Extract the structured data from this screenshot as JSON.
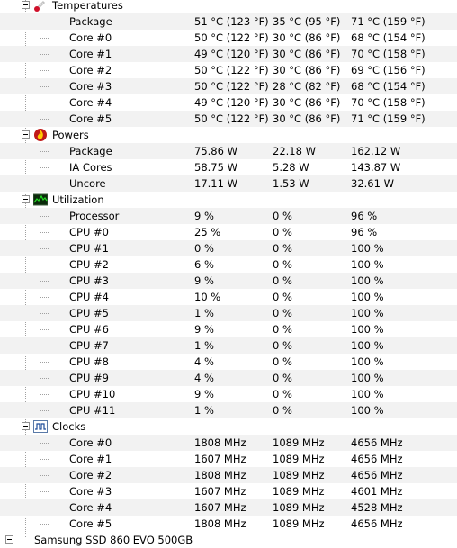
{
  "categories": [
    {
      "name": "Temperatures",
      "icon": "thermometer-icon",
      "rows": [
        {
          "label": "Package",
          "value": "51 °C  (123 °F)",
          "min": "35 °C  (95 °F)",
          "max": "71 °C  (159 °F)"
        },
        {
          "label": "Core #0",
          "value": "50 °C  (122 °F)",
          "min": "30 °C  (86 °F)",
          "max": "68 °C  (154 °F)"
        },
        {
          "label": "Core #1",
          "value": "49 °C  (120 °F)",
          "min": "30 °C  (86 °F)",
          "max": "70 °C  (158 °F)"
        },
        {
          "label": "Core #2",
          "value": "50 °C  (122 °F)",
          "min": "30 °C  (86 °F)",
          "max": "69 °C  (156 °F)"
        },
        {
          "label": "Core #3",
          "value": "50 °C  (122 °F)",
          "min": "28 °C  (82 °F)",
          "max": "68 °C  (154 °F)"
        },
        {
          "label": "Core #4",
          "value": "49 °C  (120 °F)",
          "min": "30 °C  (86 °F)",
          "max": "70 °C  (158 °F)"
        },
        {
          "label": "Core #5",
          "value": "50 °C  (122 °F)",
          "min": "30 °C  (86 °F)",
          "max": "71 °C  (159 °F)"
        }
      ]
    },
    {
      "name": "Powers",
      "icon": "power-flame-icon",
      "rows": [
        {
          "label": "Package",
          "value": "75.86 W",
          "min": "22.18 W",
          "max": "162.12 W"
        },
        {
          "label": "IA Cores",
          "value": "58.75 W",
          "min": "5.28 W",
          "max": "143.87 W"
        },
        {
          "label": "Uncore",
          "value": "17.11 W",
          "min": "1.53 W",
          "max": "32.61 W"
        }
      ]
    },
    {
      "name": "Utilization",
      "icon": "utilization-graph-icon",
      "rows": [
        {
          "label": "Processor",
          "value": "9 %",
          "min": "0 %",
          "max": "96 %"
        },
        {
          "label": "CPU #0",
          "value": "25 %",
          "min": "0 %",
          "max": "96 %"
        },
        {
          "label": "CPU #1",
          "value": "0 %",
          "min": "0 %",
          "max": "100 %"
        },
        {
          "label": "CPU #2",
          "value": "6 %",
          "min": "0 %",
          "max": "100 %"
        },
        {
          "label": "CPU #3",
          "value": "9 %",
          "min": "0 %",
          "max": "100 %"
        },
        {
          "label": "CPU #4",
          "value": "10 %",
          "min": "0 %",
          "max": "100 %"
        },
        {
          "label": "CPU #5",
          "value": "1 %",
          "min": "0 %",
          "max": "100 %"
        },
        {
          "label": "CPU #6",
          "value": "9 %",
          "min": "0 %",
          "max": "100 %"
        },
        {
          "label": "CPU #7",
          "value": "1 %",
          "min": "0 %",
          "max": "100 %"
        },
        {
          "label": "CPU #8",
          "value": "4 %",
          "min": "0 %",
          "max": "100 %"
        },
        {
          "label": "CPU #9",
          "value": "4 %",
          "min": "0 %",
          "max": "100 %"
        },
        {
          "label": "CPU #10",
          "value": "9 %",
          "min": "0 %",
          "max": "100 %"
        },
        {
          "label": "CPU #11",
          "value": "1 %",
          "min": "0 %",
          "max": "100 %"
        }
      ]
    },
    {
      "name": "Clocks",
      "icon": "clock-wave-icon",
      "rows": [
        {
          "label": "Core #0",
          "value": "1808 MHz",
          "min": "1089 MHz",
          "max": "4656 MHz"
        },
        {
          "label": "Core #1",
          "value": "1607 MHz",
          "min": "1089 MHz",
          "max": "4656 MHz"
        },
        {
          "label": "Core #2",
          "value": "1808 MHz",
          "min": "1089 MHz",
          "max": "4656 MHz"
        },
        {
          "label": "Core #3",
          "value": "1607 MHz",
          "min": "1089 MHz",
          "max": "4601 MHz"
        },
        {
          "label": "Core #4",
          "value": "1607 MHz",
          "min": "1089 MHz",
          "max": "4528 MHz"
        },
        {
          "label": "Core #5",
          "value": "1808 MHz",
          "min": "1089 MHz",
          "max": "4656 MHz"
        }
      ]
    }
  ],
  "next_item_partial": "Samsung SSD 860 EVO 500GB"
}
